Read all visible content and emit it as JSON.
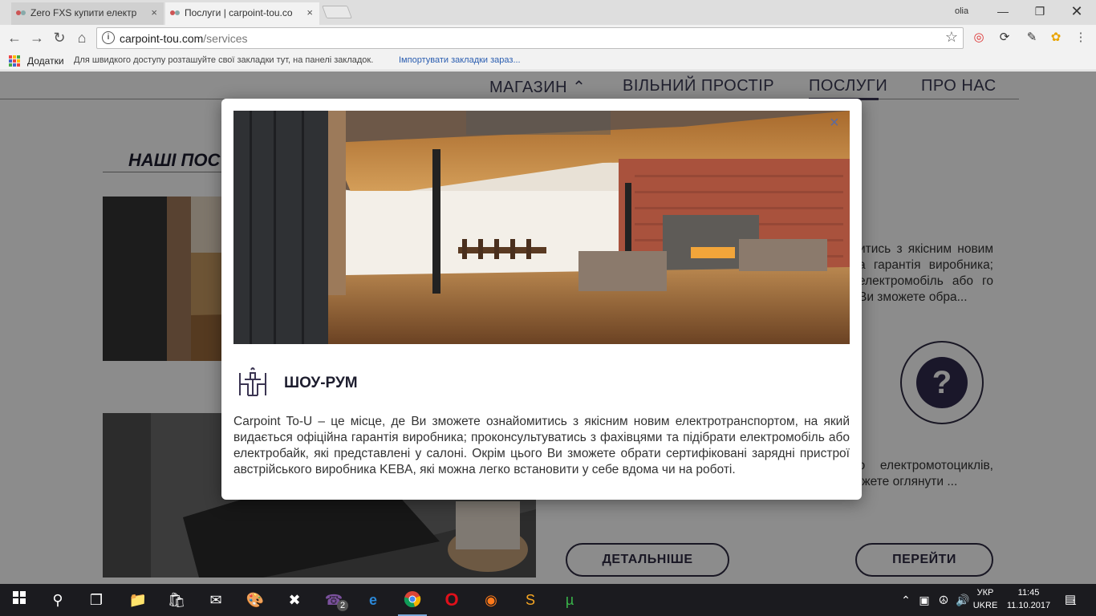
{
  "browser": {
    "tabs": [
      {
        "label": "Zero FXS купити електр",
        "close": "×"
      },
      {
        "label": "Послуги | carpoint-tou.co",
        "close": "×"
      }
    ],
    "profile": "olia",
    "url_host": "carpoint-tou.com",
    "url_path": "/services",
    "bookmarks": {
      "apps": "Додатки",
      "hint": "Для швидкого доступу розташуйте свої закладки тут, на панелі закладок.",
      "import": "Імпортувати закладки зараз..."
    }
  },
  "site": {
    "nav": [
      "МАГАЗИН ⌃",
      "ВІЛЬНИЙ ПРОСТІР",
      "ПОСЛУГИ",
      "ПРО НАС"
    ],
    "section_title": "НАШІ ПОС",
    "card1_text": "итись з якісним новим а гарантія виробника; електромобіль або го Ви зможете обра...",
    "card2_text": "нових електромобілів, його. Ми пропонуємо електромотоциклів, електровелосипедів, а також аксесуарів, які Ви зможете оглянути ...",
    "buttons": {
      "details": "ДЕТАЛЬНІШЕ",
      "go": "ПЕРЕЙТИ"
    },
    "help_icon": "?"
  },
  "modal": {
    "title": "ШОУ-РУМ",
    "close": "×",
    "body": "Carpoint To-U – це місце, де Ви зможете ознайомитись з якісним новим електротранспортом, на який видається офіційна гарантія виробника; проконсультуватись з фахівцями та підібрати електромобіль або електробайк, які представлені у салоні. Окрім цього Ви зможете обрати сертифіковані зарядні пристрої австрійського виробника KEBA, які можна легко встановити у себе вдома чи на роботі."
  },
  "taskbar": {
    "viber_badge": "2",
    "lang_top": "УКР",
    "lang_bottom": "UKRE",
    "time": "11:45",
    "date": "11.10.2017",
    "notif_count": "1"
  },
  "colors": {
    "accent": "#2e2a42",
    "link": "#2a5db0"
  }
}
